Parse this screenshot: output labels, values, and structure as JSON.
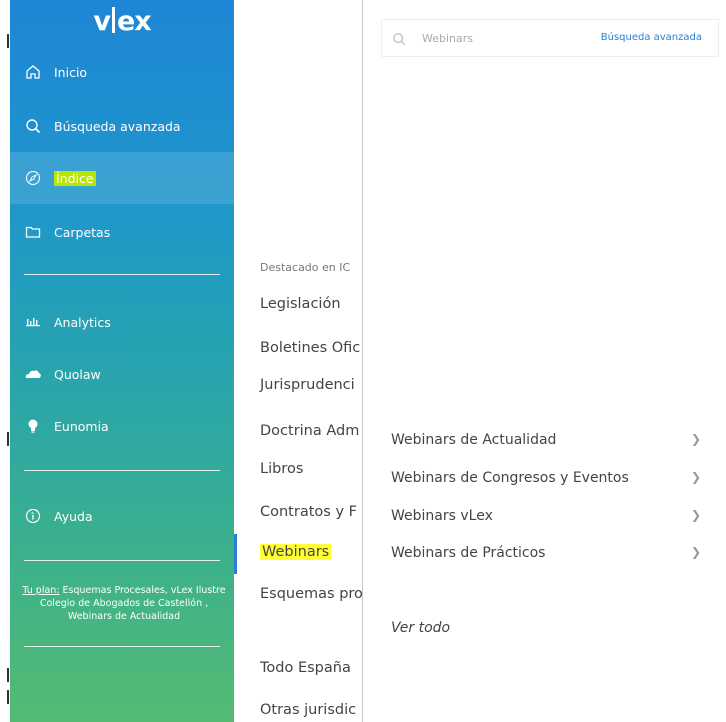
{
  "sidebar": {
    "logo": "vlex",
    "logo_left": "v",
    "logo_right": "ex",
    "items": [
      {
        "label": "Inicio",
        "icon": "home-icon"
      },
      {
        "label": "Búsqueda avanzada",
        "icon": "search-icon"
      },
      {
        "label": "Índice",
        "icon": "compass-icon",
        "active": true
      },
      {
        "label": "Carpetas",
        "icon": "folder-icon"
      },
      {
        "label": "Analytics",
        "icon": "bar-chart-icon"
      },
      {
        "label": "Quolaw",
        "icon": "cloud-icon"
      },
      {
        "label": "Eunomia",
        "icon": "lightbulb-icon"
      },
      {
        "label": "Ayuda",
        "icon": "info-icon"
      }
    ],
    "plan": {
      "link": "Tu plan:",
      "text": " Esquemas Procesales, vLex Ilustre Colegio de Abogados de Castellón , Webinars de Actualidad"
    }
  },
  "middle": {
    "header": "Destacado en IC",
    "items": [
      "Legislación",
      "Boletines Ofic",
      "Jurisprudenci",
      "Doctrina Adm",
      "Libros",
      "Contratos y F",
      "Webinars",
      "Esquemas pro",
      "Todo España",
      "Otras jurisdic"
    ],
    "active_item": "Webinars"
  },
  "search": {
    "placeholder": "Webinars",
    "advanced_label": "Búsqueda avanzada"
  },
  "submenu": {
    "items": [
      "Webinars de Actualidad",
      "Webinars de Congresos y Eventos",
      "Webinars vLex",
      "Webinars de Prácticos"
    ],
    "view_all": "Ver todo"
  },
  "colors": {
    "accent_blue": "#2a7fd4",
    "highlight_yellow": "#ffff33",
    "highlight_green": "#b8e600"
  }
}
